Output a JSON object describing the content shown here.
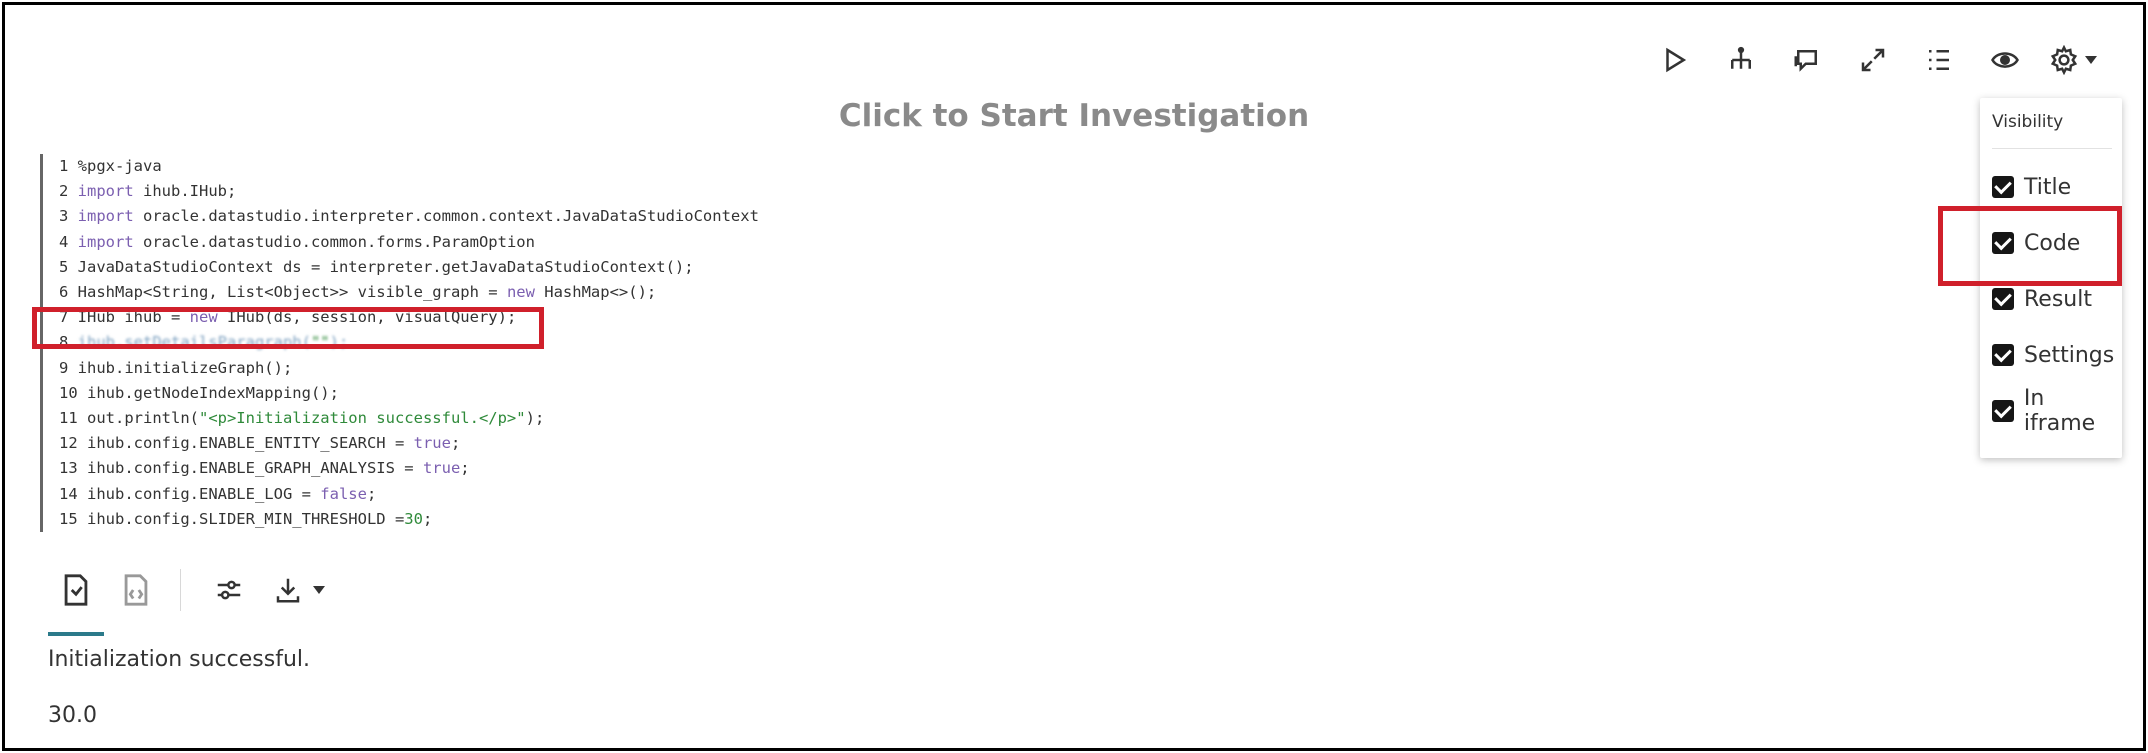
{
  "paragraph": {
    "title": "Click to Start Investigation"
  },
  "toolbar": {
    "icons": [
      "run-icon",
      "hierarchy-icon",
      "comment-icon",
      "expand-icon",
      "list-icon",
      "eye-icon",
      "gear-icon"
    ]
  },
  "code": {
    "lines": [
      {
        "n": "1",
        "text": "%pgx-java"
      },
      {
        "n": "2",
        "kw": "import",
        "text": " ihub.IHub;"
      },
      {
        "n": "3",
        "kw": "import",
        "text": " oracle.datastudio.interpreter.common.context.JavaDataStudioContext"
      },
      {
        "n": "4",
        "kw": "import",
        "text": " oracle.datastudio.common.forms.ParamOption"
      },
      {
        "n": "5",
        "text": "JavaDataStudioContext ds = interpreter.getJavaDataStudioContext();"
      },
      {
        "n": "6",
        "text": "HashMap<String, List<Object>> visible_graph = new HashMap<>();"
      },
      {
        "n": "7",
        "text": "IHub ihub = new IHub(ds, session, visualQuery);"
      },
      {
        "n": "8",
        "text": "ihub.setDetailsParagraph(\"\");"
      },
      {
        "n": "9",
        "text": "ihub.initializeGraph();"
      },
      {
        "n": "10",
        "text": "ihub.getNodeIndexMapping();"
      },
      {
        "n": "11",
        "text": "out.println(\"<p>Initialization successful.</p>\");"
      },
      {
        "n": "12",
        "text": "ihub.config.ENABLE_ENTITY_SEARCH = true;"
      },
      {
        "n": "13",
        "text": "ihub.config.ENABLE_GRAPH_ANALYSIS = true;"
      },
      {
        "n": "14",
        "text": "ihub.config.ENABLE_LOG = false;"
      },
      {
        "n": "15",
        "text": "ihub.config.SLIDER_MIN_THRESHOLD =30;"
      }
    ]
  },
  "result": {
    "tabs": [
      "result-icon",
      "html-icon",
      "settings-icon",
      "download-icon"
    ],
    "output": [
      "Initialization successful.",
      "30.0"
    ]
  },
  "visibility": {
    "heading": "Visibility",
    "items": [
      {
        "label": "Title",
        "checked": true
      },
      {
        "label": "Code",
        "checked": true
      },
      {
        "label": "Result",
        "checked": true
      },
      {
        "label": "Settings",
        "checked": true
      },
      {
        "label": "In iframe",
        "checked": true
      }
    ]
  },
  "colors": {
    "highlight": "#d0202b",
    "keyword": "#7b5fb0",
    "string": "#2f8a3a",
    "active_tab": "#2b7a8a"
  }
}
